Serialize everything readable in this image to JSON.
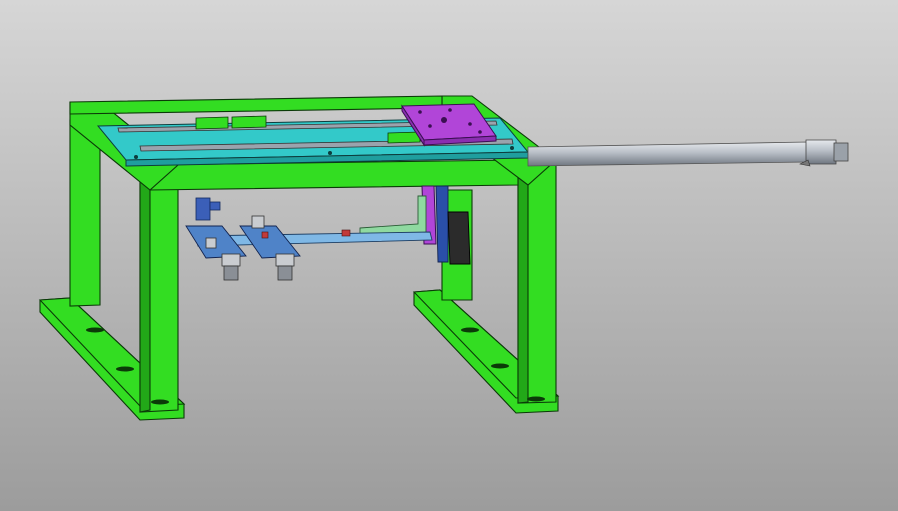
{
  "viewport": {
    "background_top": "#d6d6d6",
    "background_bottom": "#9c9c9c"
  },
  "model": {
    "frame_color": "#33dd22",
    "frame_shadow": "#22a818",
    "frame_edge": "#0b3a08",
    "plate_color": "#33c9c9",
    "plate_dark": "#1f9e9e",
    "carriage_color": "#b145d8",
    "carriage_dark": "#8a2fb0",
    "rail_color": "#9aa3ad",
    "bracket_color": "#4f83c8",
    "bracket_dark": "#2a4fa8",
    "arm_color": "#7fb8e6",
    "rod_color": "#b8bec6",
    "rod_dark": "#7a828c",
    "motor_color": "#2b2b2b",
    "lgreen": "#8fd9a0"
  }
}
